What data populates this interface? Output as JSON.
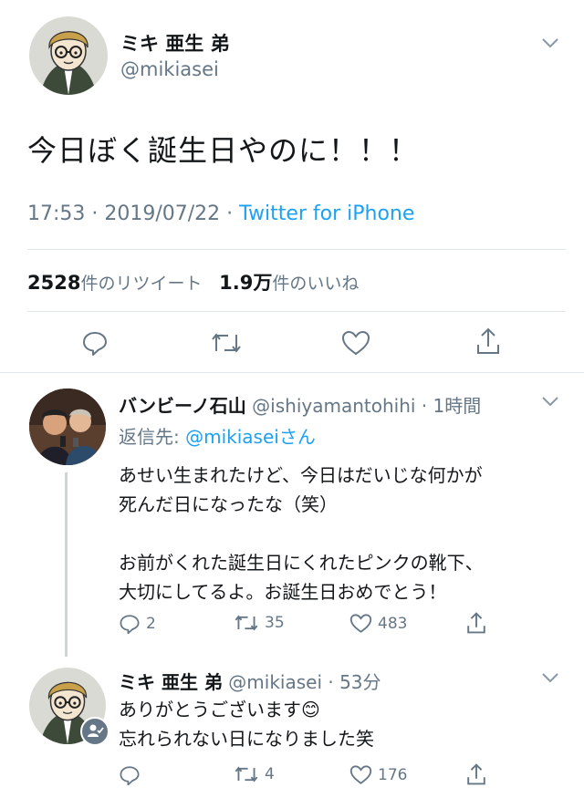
{
  "main_tweet": {
    "display_name": "ミキ 亜生 弟",
    "handle": "@mikiasei",
    "text": "今日ぼく誕生日やのに！！！",
    "time": "17:53 · 2019/07/22 · ",
    "source": "Twitter for iPhone",
    "retweet_count": "2528",
    "retweet_label": "件のリツイート",
    "like_count": "1.9万",
    "like_label": "件のいいね"
  },
  "reply1": {
    "display_name": "バンビーノ石山",
    "handle_time": "@ishiyamantohihi · 1時間",
    "reply_to_prefix": "返信先: ",
    "reply_to_handle": "@mikiaseiさん",
    "line1": "あせい生まれたけど、今日はだいじな何かが",
    "line2": "死んだ日になったな（笑）",
    "line3": "お前がくれた誕生日にくれたピンクの靴下、",
    "line4": "大切にしてるよ。お誕生日おめでとう！",
    "replies": "2",
    "retweets": "35",
    "likes": "483"
  },
  "reply2": {
    "display_name": "ミキ 亜生 弟",
    "handle_time": "@mikiasei · 53分",
    "line1": "ありがとうございます😊",
    "line2": "忘れられない日になりました笑",
    "replies": "",
    "retweets": "4",
    "likes": "176"
  },
  "colors": {
    "accent": "#1da1f2",
    "secondary_text": "#657786",
    "divider": "#e1e8ed"
  }
}
